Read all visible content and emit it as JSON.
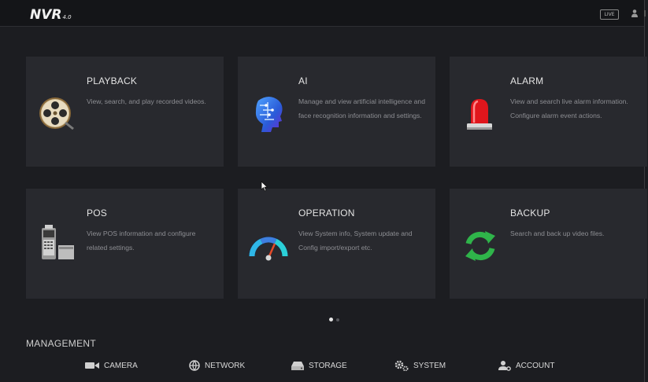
{
  "header": {
    "logo_text": "NVR",
    "logo_version": "4.0",
    "live_label": "LIVE",
    "user_icon": "user-icon"
  },
  "tiles": [
    {
      "title": "PLAYBACK",
      "desc": "View, search, and play recorded videos.",
      "icon": "film-reel-icon"
    },
    {
      "title": "AI",
      "desc": "Manage and view artificial intelligence and face recognition information and settings.",
      "icon": "ai-head-icon"
    },
    {
      "title": "ALARM",
      "desc": "View and search live alarm information. Configure alarm event actions.",
      "icon": "alarm-siren-icon"
    },
    {
      "title": "POS",
      "desc": "View POS information and configure related settings.",
      "icon": "pos-terminal-icon"
    },
    {
      "title": "OPERATION",
      "desc": "View System info, System update and Config import/export etc.",
      "icon": "gauge-icon"
    },
    {
      "title": "BACKUP",
      "desc": "Search and back up video files.",
      "icon": "refresh-arrows-icon"
    }
  ],
  "pagination": {
    "current_page": 1,
    "total_pages": 2
  },
  "management": {
    "title": "MANAGEMENT",
    "items": [
      {
        "label": "CAMERA",
        "icon": "camera-icon"
      },
      {
        "label": "NETWORK",
        "icon": "network-globe-icon"
      },
      {
        "label": "STORAGE",
        "icon": "storage-drive-icon"
      },
      {
        "label": "SYSTEM",
        "icon": "gears-icon"
      },
      {
        "label": "ACCOUNT",
        "icon": "account-user-icon"
      }
    ]
  },
  "colors": {
    "background": "#1c1d21",
    "tile": "#28292e",
    "alarm_red": "#e0161c",
    "backup_green": "#2fb44a",
    "ai_blue": "#2a5bd8"
  }
}
